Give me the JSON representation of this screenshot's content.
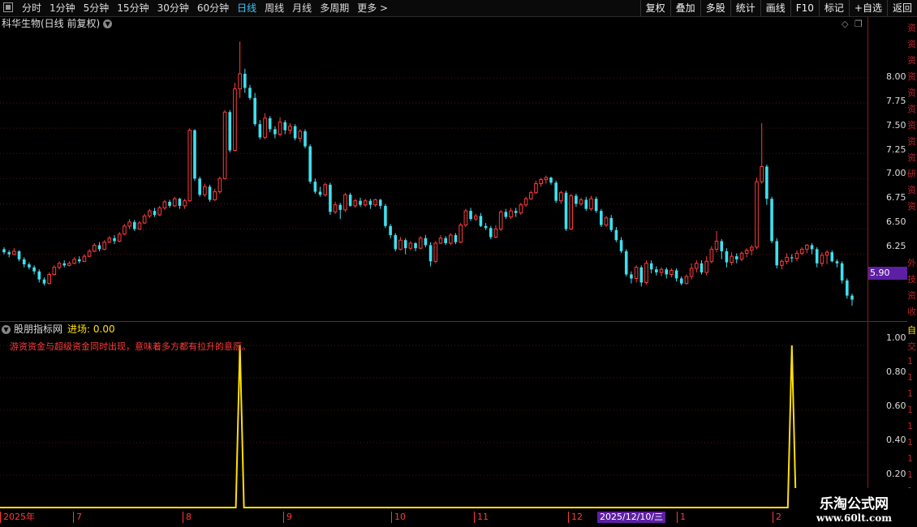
{
  "toolbar": {
    "periods": [
      "分时",
      "1分钟",
      "5分钟",
      "15分钟",
      "30分钟",
      "60分钟",
      "日线",
      "周线",
      "月线",
      "多周期",
      "更多 >"
    ],
    "active_period": "日线",
    "actions": [
      "复权",
      "叠加",
      "多股",
      "统计",
      "画线",
      "F10",
      "标记",
      "+自选",
      "返回"
    ]
  },
  "main_chart": {
    "title": "科华生物(日线 前复权)",
    "y_ticks": [
      "8.00",
      "7.75",
      "7.50",
      "7.25",
      "7.00",
      "6.75",
      "6.50",
      "6.25"
    ],
    "last_price_tag": "5.90",
    "side_clip_chars": [
      "资",
      "资",
      "资",
      "资",
      "资",
      "资",
      "资",
      "资",
      "资",
      "研",
      "资",
      "资",
      "外",
      "技",
      "资",
      "收"
    ]
  },
  "indicator": {
    "name": "股朋指标网",
    "value_label": "进场: 0.00",
    "note": "游资资金与超级资金同时出现，意味着多方都有拉升的意愿。",
    "y_ticks": [
      "1.00",
      "0.80",
      "0.60",
      "0.40",
      "0.20"
    ],
    "side_clip_chars": [
      "自",
      "交",
      "1",
      "1",
      "1",
      "1",
      "1",
      "1",
      "1",
      "1",
      "1"
    ]
  },
  "x_axis": {
    "labels": [
      "2025年",
      "7",
      "8",
      "9",
      "10",
      "11",
      "12",
      "1",
      "2"
    ],
    "cursor_label": "2025/12/10/三"
  },
  "watermark": {
    "line1": "乐淘公式网",
    "line2": "www.60lt.com"
  },
  "colors": {
    "up": "#ff3b3b",
    "down": "#3fe0ee",
    "signal": "#ffe000",
    "axis": "#8b1a1a",
    "cursor_bg": "#5d1fa3"
  },
  "chart_data": {
    "type": "candlestick",
    "title": "科华生物(日线 前复权)",
    "ylim": [
      5.7,
      8.45
    ],
    "candles": [
      [
        6.3,
        6.27,
        6.32,
        6.25
      ],
      [
        6.27,
        6.25,
        6.29,
        6.22
      ],
      [
        6.25,
        6.28,
        6.31,
        6.24
      ],
      [
        6.28,
        6.2,
        6.29,
        6.18
      ],
      [
        6.2,
        6.15,
        6.22,
        6.12
      ],
      [
        6.15,
        6.12,
        6.17,
        6.1
      ],
      [
        6.12,
        6.08,
        6.14,
        6.05
      ],
      [
        6.08,
        6.0,
        6.1,
        5.97
      ],
      [
        6.0,
        5.96,
        6.02,
        5.94
      ],
      [
        5.96,
        6.05,
        6.07,
        5.95
      ],
      [
        6.05,
        6.12,
        6.14,
        6.04
      ],
      [
        6.12,
        6.16,
        6.18,
        6.1
      ],
      [
        6.16,
        6.14,
        6.19,
        6.12
      ],
      [
        6.14,
        6.16,
        6.18,
        6.13
      ],
      [
        6.16,
        6.2,
        6.22,
        6.15
      ],
      [
        6.2,
        6.18,
        6.23,
        6.16
      ],
      [
        6.18,
        6.23,
        6.25,
        6.17
      ],
      [
        6.23,
        6.28,
        6.3,
        6.22
      ],
      [
        6.28,
        6.34,
        6.36,
        6.27
      ],
      [
        6.34,
        6.3,
        6.37,
        6.28
      ],
      [
        6.3,
        6.37,
        6.39,
        6.29
      ],
      [
        6.37,
        6.41,
        6.43,
        6.36
      ],
      [
        6.41,
        6.38,
        6.44,
        6.35
      ],
      [
        6.38,
        6.45,
        6.47,
        6.37
      ],
      [
        6.45,
        6.53,
        6.55,
        6.44
      ],
      [
        6.53,
        6.57,
        6.6,
        6.5
      ],
      [
        6.57,
        6.5,
        6.59,
        6.48
      ],
      [
        6.5,
        6.56,
        6.58,
        6.49
      ],
      [
        6.56,
        6.63,
        6.65,
        6.55
      ],
      [
        6.63,
        6.68,
        6.7,
        6.61
      ],
      [
        6.68,
        6.64,
        6.71,
        6.62
      ],
      [
        6.64,
        6.71,
        6.73,
        6.63
      ],
      [
        6.71,
        6.77,
        6.79,
        6.69
      ],
      [
        6.77,
        6.73,
        6.79,
        6.71
      ],
      [
        6.73,
        6.8,
        6.82,
        6.72
      ],
      [
        6.8,
        6.73,
        6.81,
        6.7
      ],
      [
        6.73,
        6.78,
        6.8,
        6.7
      ],
      [
        6.78,
        7.48,
        7.5,
        6.77
      ],
      [
        7.48,
        7.0,
        7.49,
        6.98
      ],
      [
        7.0,
        6.84,
        7.02,
        6.82
      ],
      [
        6.84,
        6.92,
        6.95,
        6.82
      ],
      [
        6.92,
        6.79,
        6.94,
        6.77
      ],
      [
        6.79,
        6.87,
        6.9,
        6.78
      ],
      [
        6.87,
        7.0,
        7.02,
        6.85
      ],
      [
        7.0,
        7.66,
        7.68,
        6.99
      ],
      [
        7.66,
        7.28,
        7.68,
        7.26
      ],
      [
        7.28,
        7.89,
        7.95,
        7.27
      ],
      [
        7.89,
        8.04,
        8.36,
        7.8
      ],
      [
        8.04,
        7.9,
        8.09,
        7.85
      ],
      [
        7.9,
        7.8,
        7.93,
        7.78
      ],
      [
        7.8,
        7.54,
        7.85,
        7.52
      ],
      [
        7.54,
        7.41,
        7.58,
        7.39
      ],
      [
        7.41,
        7.6,
        7.65,
        7.39
      ],
      [
        7.6,
        7.49,
        7.62,
        7.46
      ],
      [
        7.49,
        7.44,
        7.52,
        7.4
      ],
      [
        7.44,
        7.56,
        7.61,
        7.42
      ],
      [
        7.56,
        7.48,
        7.58,
        7.44
      ],
      [
        7.48,
        7.52,
        7.55,
        7.44
      ],
      [
        7.52,
        7.4,
        7.54,
        7.38
      ],
      [
        7.4,
        7.47,
        7.49,
        7.36
      ],
      [
        7.47,
        7.32,
        7.49,
        7.3
      ],
      [
        7.32,
        6.97,
        7.34,
        6.95
      ],
      [
        6.97,
        6.87,
        7.0,
        6.85
      ],
      [
        6.87,
        6.84,
        6.92,
        6.82
      ],
      [
        6.84,
        6.94,
        6.96,
        6.82
      ],
      [
        6.94,
        6.67,
        6.96,
        6.64
      ],
      [
        6.67,
        6.74,
        6.77,
        6.65
      ],
      [
        6.74,
        6.69,
        6.76,
        6.6
      ],
      [
        6.69,
        6.84,
        6.86,
        6.67
      ],
      [
        6.84,
        6.73,
        6.86,
        6.72
      ],
      [
        6.73,
        6.78,
        6.8,
        6.71
      ],
      [
        6.78,
        6.74,
        6.81,
        6.72
      ],
      [
        6.74,
        6.78,
        6.8,
        6.72
      ],
      [
        6.78,
        6.74,
        6.8,
        6.7
      ],
      [
        6.74,
        6.79,
        6.8,
        6.72
      ],
      [
        6.79,
        6.73,
        6.8,
        6.7
      ],
      [
        6.73,
        6.53,
        6.75,
        6.51
      ],
      [
        6.53,
        6.44,
        6.55,
        6.41
      ],
      [
        6.44,
        6.3,
        6.46,
        6.28
      ],
      [
        6.3,
        6.39,
        6.42,
        6.29
      ],
      [
        6.39,
        6.31,
        6.41,
        6.25
      ],
      [
        6.31,
        6.36,
        6.38,
        6.29
      ],
      [
        6.36,
        6.31,
        6.37,
        6.28
      ],
      [
        6.31,
        6.41,
        6.43,
        6.3
      ],
      [
        6.41,
        6.34,
        6.44,
        6.32
      ],
      [
        6.34,
        6.18,
        6.37,
        6.13
      ],
      [
        6.18,
        6.36,
        6.38,
        6.16
      ],
      [
        6.36,
        6.41,
        6.44,
        6.35
      ],
      [
        6.41,
        6.36,
        6.43,
        6.34
      ],
      [
        6.36,
        6.44,
        6.46,
        6.34
      ],
      [
        6.44,
        6.37,
        6.46,
        6.35
      ],
      [
        6.37,
        6.54,
        6.56,
        6.36
      ],
      [
        6.54,
        6.68,
        6.7,
        6.52
      ],
      [
        6.68,
        6.6,
        6.71,
        6.58
      ],
      [
        6.6,
        6.63,
        6.65,
        6.58
      ],
      [
        6.63,
        6.53,
        6.66,
        6.52
      ],
      [
        6.53,
        6.51,
        6.56,
        6.49
      ],
      [
        6.51,
        6.42,
        6.53,
        6.4
      ],
      [
        6.42,
        6.5,
        6.54,
        6.41
      ],
      [
        6.5,
        6.67,
        6.69,
        6.48
      ],
      [
        6.67,
        6.62,
        6.7,
        6.6
      ],
      [
        6.62,
        6.68,
        6.71,
        6.6
      ],
      [
        6.68,
        6.66,
        6.71,
        6.62
      ],
      [
        6.66,
        6.74,
        6.76,
        6.64
      ],
      [
        6.74,
        6.8,
        6.82,
        6.72
      ],
      [
        6.8,
        6.86,
        6.88,
        6.79
      ],
      [
        6.86,
        6.95,
        6.98,
        6.85
      ],
      [
        6.95,
        6.99,
        7.01,
        6.92
      ],
      [
        6.99,
        7.01,
        7.03,
        6.95
      ],
      [
        7.01,
        6.96,
        7.02,
        6.94
      ],
      [
        6.96,
        6.78,
        6.98,
        6.76
      ],
      [
        6.78,
        6.86,
        6.88,
        6.75
      ],
      [
        6.86,
        6.5,
        6.88,
        6.48
      ],
      [
        6.5,
        6.83,
        6.85,
        6.49
      ],
      [
        6.83,
        6.75,
        6.85,
        6.72
      ],
      [
        6.75,
        6.79,
        6.81,
        6.73
      ],
      [
        6.79,
        6.7,
        6.82,
        6.68
      ],
      [
        6.7,
        6.8,
        6.83,
        6.68
      ],
      [
        6.8,
        6.68,
        6.82,
        6.66
      ],
      [
        6.68,
        6.54,
        6.7,
        6.52
      ],
      [
        6.54,
        6.61,
        6.63,
        6.52
      ],
      [
        6.61,
        6.49,
        6.64,
        6.47
      ],
      [
        6.49,
        6.39,
        6.52,
        6.37
      ],
      [
        6.39,
        6.28,
        6.42,
        6.26
      ],
      [
        6.28,
        6.05,
        6.3,
        6.03
      ],
      [
        6.05,
        6.01,
        6.08,
        5.96
      ],
      [
        6.01,
        6.12,
        6.14,
        5.97
      ],
      [
        6.12,
        5.97,
        6.14,
        5.93
      ],
      [
        5.97,
        6.16,
        6.19,
        5.95
      ],
      [
        6.16,
        6.1,
        6.19,
        6.06
      ],
      [
        6.1,
        6.07,
        6.13,
        6.04
      ],
      [
        6.07,
        6.1,
        6.12,
        6.03
      ],
      [
        6.1,
        6.05,
        6.12,
        6.01
      ],
      [
        6.05,
        6.09,
        6.11,
        6.02
      ],
      [
        6.09,
        6.01,
        6.11,
        5.98
      ],
      [
        6.01,
        5.96,
        6.03,
        5.94
      ],
      [
        5.96,
        6.03,
        6.05,
        5.95
      ],
      [
        6.03,
        6.11,
        6.16,
        6.0
      ],
      [
        6.11,
        6.16,
        6.19,
        6.07
      ],
      [
        6.16,
        6.07,
        6.19,
        6.05
      ],
      [
        6.07,
        6.18,
        6.23,
        6.04
      ],
      [
        6.18,
        6.3,
        6.33,
        6.16
      ],
      [
        6.3,
        6.38,
        6.48,
        6.27
      ],
      [
        6.38,
        6.28,
        6.4,
        6.2
      ],
      [
        6.28,
        6.17,
        6.31,
        6.12
      ],
      [
        6.17,
        6.23,
        6.27,
        6.14
      ],
      [
        6.23,
        6.2,
        6.26,
        6.16
      ],
      [
        6.2,
        6.26,
        6.28,
        6.18
      ],
      [
        6.26,
        6.29,
        6.31,
        6.22
      ],
      [
        6.29,
        6.32,
        6.34,
        6.24
      ],
      [
        6.32,
        6.97,
        7.01,
        6.3
      ],
      [
        6.97,
        7.12,
        7.55,
        6.95
      ],
      [
        7.12,
        6.8,
        7.14,
        6.74
      ],
      [
        6.8,
        6.38,
        6.82,
        6.36
      ],
      [
        6.38,
        6.14,
        6.41,
        6.11
      ],
      [
        6.14,
        6.18,
        6.2,
        6.1
      ],
      [
        6.18,
        6.22,
        6.26,
        6.15
      ],
      [
        6.22,
        6.21,
        6.25,
        6.17
      ],
      [
        6.21,
        6.26,
        6.29,
        6.18
      ],
      [
        6.26,
        6.3,
        6.32,
        6.24
      ],
      [
        6.3,
        6.34,
        6.35,
        6.26
      ],
      [
        6.34,
        6.3,
        6.36,
        6.25
      ],
      [
        6.3,
        6.16,
        6.32,
        6.12
      ],
      [
        6.16,
        6.24,
        6.27,
        6.13
      ],
      [
        6.24,
        6.27,
        6.29,
        6.15
      ],
      [
        6.27,
        6.18,
        6.29,
        6.17
      ],
      [
        6.18,
        6.16,
        6.2,
        6.12
      ],
      [
        6.16,
        5.99,
        6.18,
        5.96
      ],
      [
        5.99,
        5.84,
        6.01,
        5.81
      ],
      [
        5.84,
        5.8,
        5.86,
        5.74
      ]
    ],
    "indicator_series": {
      "name": "进场",
      "ylim": [
        0,
        1.05
      ],
      "signal_candle_indexes": [
        47,
        157
      ]
    }
  }
}
